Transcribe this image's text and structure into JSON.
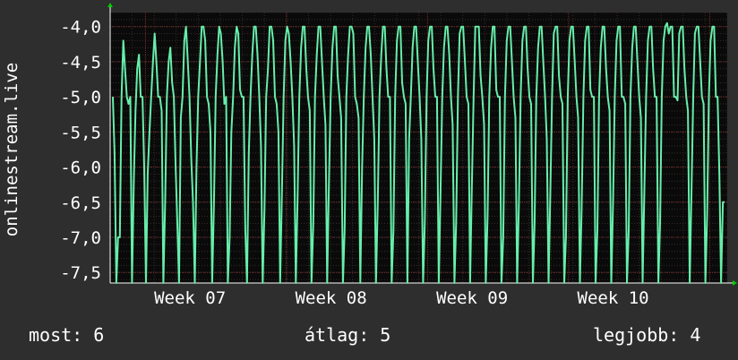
{
  "chart_data": {
    "type": "line",
    "title": "",
    "ylabel": "onlinestream.live",
    "xlabel": "",
    "ylim": [
      -7.65,
      -3.8
    ],
    "yticks": [
      -4.0,
      -4.5,
      -5.0,
      -5.5,
      -6.0,
      -6.5,
      -7.0,
      -7.5
    ],
    "yticklabels": [
      "-4,0",
      "-4,5",
      "-5,0",
      "-5,5",
      "-6,0",
      "-6,5",
      "-7,0",
      "-7,5"
    ],
    "x_range_days": [
      0,
      28
    ],
    "xticks": [
      2.2,
      8.6,
      15.0,
      21.4
    ],
    "xticklabels": [
      "Week 07",
      "Week 08",
      "Week 09",
      "Week 10"
    ],
    "grid": true,
    "line_color": "#66eeaa",
    "series": [
      {
        "values": [
          -5.0,
          -5.8,
          -7.65,
          -7.0,
          -7.0,
          -5.0,
          -4.2,
          -4.6,
          -5.0,
          -5.1,
          -5.0,
          -7.65,
          -6.2,
          -5.2,
          -4.6,
          -4.4,
          -5.0,
          -5.0,
          -6.0,
          -7.65,
          -6.1,
          -5.5,
          -5.0,
          -4.5,
          -4.1,
          -4.5,
          -5.0,
          -5.0,
          -5.2,
          -7.65,
          -6.5,
          -5.0,
          -4.5,
          -4.3,
          -4.8,
          -5.0,
          -6.0,
          -6.8,
          -7.65,
          -5.3,
          -5.0,
          -4.2,
          -4.0,
          -4.5,
          -5.0,
          -5.9,
          -6.5,
          -7.65,
          -6.0,
          -5.0,
          -4.5,
          -4.0,
          -4.0,
          -4.2,
          -5.0,
          -5.1,
          -5.5,
          -7.65,
          -6.5,
          -5.0,
          -4.4,
          -4.0,
          -4.1,
          -4.5,
          -5.1,
          -5.0,
          -7.65,
          -7.0,
          -5.5,
          -5.0,
          -4.3,
          -4.0,
          -4.1,
          -4.9,
          -5.0,
          -5.0,
          -6.9,
          -7.65,
          -5.8,
          -5.0,
          -4.4,
          -4.0,
          -4.0,
          -4.4,
          -5.0,
          -5.7,
          -7.65,
          -6.6,
          -5.0,
          -4.6,
          -4.0,
          -4.0,
          -4.2,
          -5.0,
          -5.1,
          -5.5,
          -7.65,
          -6.4,
          -5.0,
          -4.2,
          -4.0,
          -4.1,
          -4.5,
          -5.0,
          -5.7,
          -7.65,
          -6.4,
          -5.0,
          -4.3,
          -4.0,
          -4.0,
          -4.6,
          -5.0,
          -5.2,
          -7.65,
          -6.8,
          -5.0,
          -4.4,
          -4.0,
          -4.0,
          -4.5,
          -5.0,
          -5.4,
          -7.65,
          -6.2,
          -5.0,
          -4.3,
          -4.0,
          -4.0,
          -4.7,
          -5.0,
          -5.3,
          -7.65,
          -6.9,
          -5.0,
          -4.4,
          -4.0,
          -4.0,
          -4.1,
          -5.0,
          -5.1,
          -5.3,
          -7.65,
          -6.0,
          -5.0,
          -4.3,
          -4.0,
          -4.0,
          -4.4,
          -5.0,
          -5.6,
          -7.65,
          -6.5,
          -5.0,
          -4.4,
          -4.0,
          -4.0,
          -4.6,
          -5.0,
          -5.0,
          -7.65,
          -6.9,
          -5.0,
          -4.2,
          -4.0,
          -4.0,
          -4.8,
          -5.0,
          -5.1,
          -7.65,
          -5.6,
          -5.0,
          -4.3,
          -4.0,
          -4.0,
          -4.5,
          -5.0,
          -5.6,
          -7.65,
          -6.8,
          -5.0,
          -4.2,
          -4.0,
          -4.0,
          -4.6,
          -5.0,
          -5.0,
          -7.65,
          -6.4,
          -5.0,
          -4.3,
          -4.0,
          -4.0,
          -4.4,
          -5.0,
          -5.4,
          -7.65,
          -6.8,
          -5.0,
          -4.1,
          -4.0,
          -4.0,
          -4.5,
          -5.0,
          -5.1,
          -7.65,
          -6.3,
          -5.0,
          -4.0,
          -4.0,
          -4.0,
          -4.7,
          -5.0,
          -5.4,
          -7.65,
          -6.7,
          -5.0,
          -4.3,
          -4.0,
          -4.0,
          -4.9,
          -5.0,
          -5.0,
          -7.65,
          -7.0,
          -5.0,
          -4.2,
          -4.0,
          -4.0,
          -4.5,
          -5.0,
          -5.3,
          -7.65,
          -6.5,
          -5.0,
          -4.2,
          -4.0,
          -4.0,
          -4.6,
          -5.0,
          -5.1,
          -7.65,
          -6.8,
          -5.0,
          -4.3,
          -4.0,
          -4.0,
          -4.5,
          -5.0,
          -5.6,
          -7.65,
          -6.4,
          -5.0,
          -4.1,
          -4.0,
          -4.0,
          -4.7,
          -5.0,
          -5.1,
          -7.65,
          -7.0,
          -5.0,
          -4.2,
          -4.0,
          -4.0,
          -4.5,
          -5.0,
          -5.3,
          -7.65,
          -6.6,
          -5.0,
          -4.2,
          -4.0,
          -4.0,
          -4.9,
          -5.0,
          -5.0,
          -7.65,
          -6.9,
          -5.0,
          -4.3,
          -4.0,
          -4.0,
          -4.6,
          -5.0,
          -5.2,
          -7.65,
          -6.5,
          -5.0,
          -4.2,
          -4.0,
          -4.0,
          -5.0,
          -5.0,
          -5.1,
          -7.65,
          -6.9,
          -5.0,
          -4.3,
          -4.0,
          -4.0,
          -4.5,
          -5.0,
          -5.3,
          -7.65,
          -6.3,
          -5.0,
          -4.2,
          -4.0,
          -4.0,
          -4.6,
          -5.0,
          -5.0,
          -7.65,
          -6.8,
          -5.0,
          -4.2,
          -4.0,
          -3.95,
          -4.1,
          -4.0,
          -4.0,
          -5.0,
          -5.0,
          -5.05,
          -4.1,
          -4.0,
          -4.0,
          -4.6,
          -5.0,
          -5.2,
          -7.65,
          -6.4,
          -5.0,
          -4.1,
          -4.0,
          -4.0,
          -4.5,
          -5.0,
          -5.1,
          -7.65,
          -6.7,
          -5.0,
          -4.2,
          -4.0,
          -4.0,
          -5.0,
          -5.0,
          -6.1,
          -7.65,
          -6.5,
          -6.5
        ]
      }
    ]
  },
  "legend": {
    "now_label": "most:",
    "now_value": "6",
    "avg_label": "átlag:",
    "avg_value": "5",
    "max_label": "legjobb:",
    "max_value": "4"
  }
}
